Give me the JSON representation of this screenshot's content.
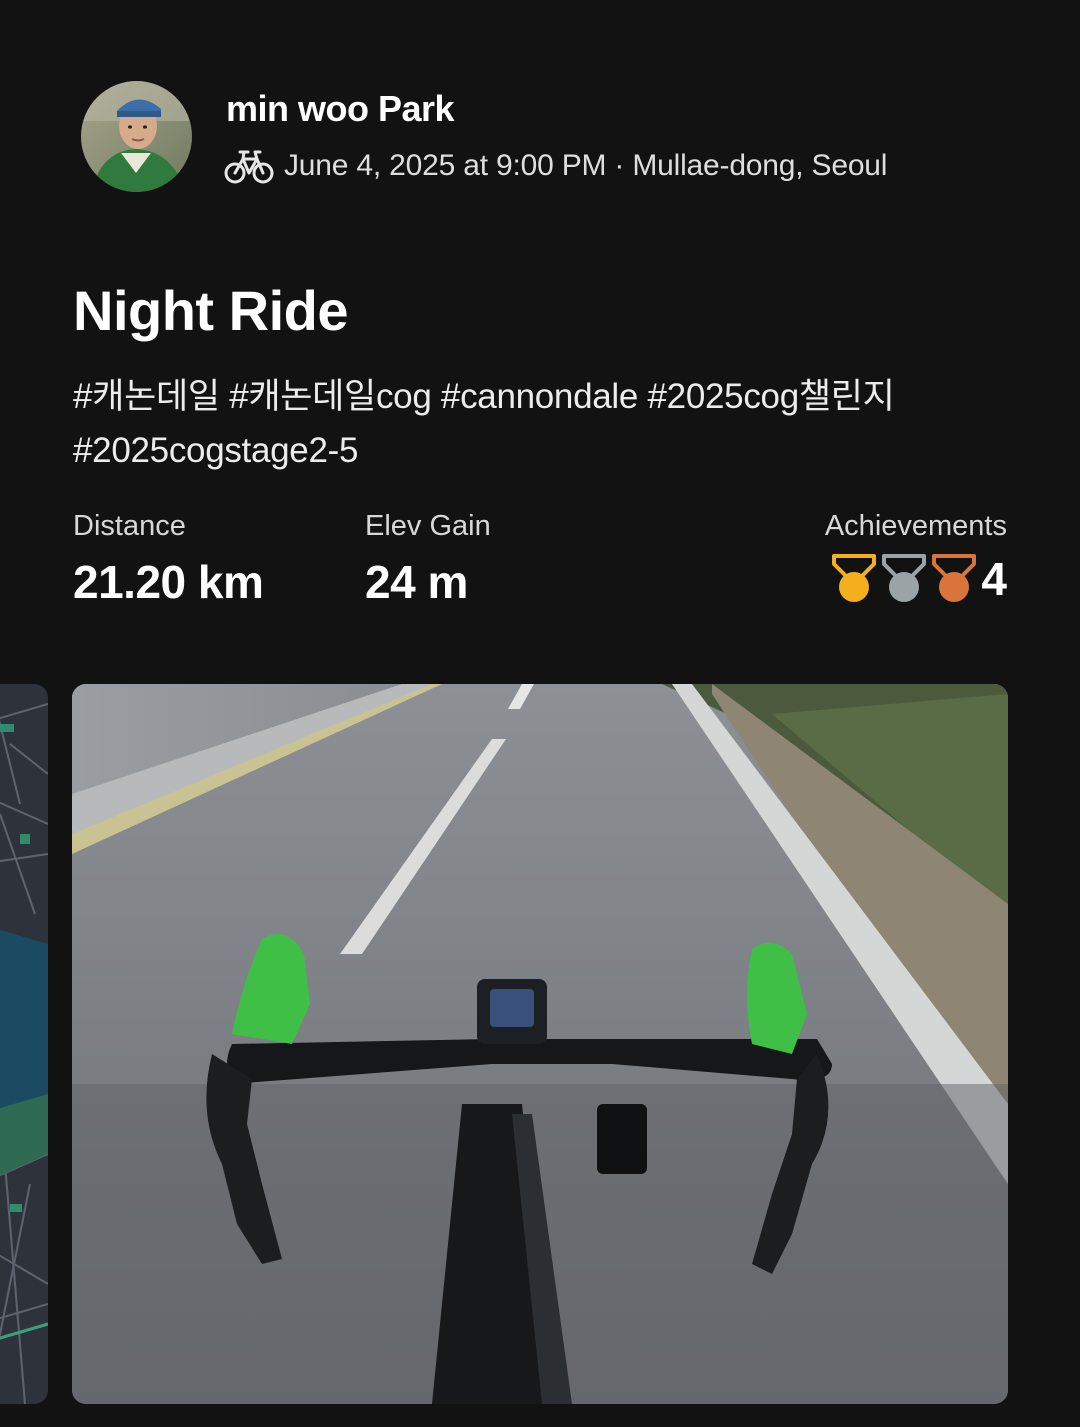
{
  "athlete": {
    "name": "min woo Park",
    "activity_icon": "bike-icon"
  },
  "activity": {
    "meta": "June 4, 2025 at 9:00 PM · Mullae-dong, Seoul",
    "title": "Night Ride",
    "description": "#캐논데일 #캐논데일cog #cannondale #2025cog챌린지 #2025cogstage2-5"
  },
  "stats": {
    "distance": {
      "label": "Distance",
      "value": "21.20 km"
    },
    "elev_gain": {
      "label": "Elev Gain",
      "value": "24 m"
    },
    "achievements": {
      "label": "Achievements",
      "count": "4",
      "medals": [
        {
          "icon": "gold-medal-icon",
          "color": "#f2b01e"
        },
        {
          "icon": "silver-medal-icon",
          "color": "#9aa3a6"
        },
        {
          "icon": "bronze-medal-icon",
          "color": "#d9743a"
        }
      ]
    }
  },
  "media": {
    "map_icon": "route-map-icon",
    "photo_icon": "ride-photo-icon"
  },
  "colors": {
    "background": "#121212",
    "text_primary": "#ffffff",
    "text_secondary": "#dedede"
  }
}
